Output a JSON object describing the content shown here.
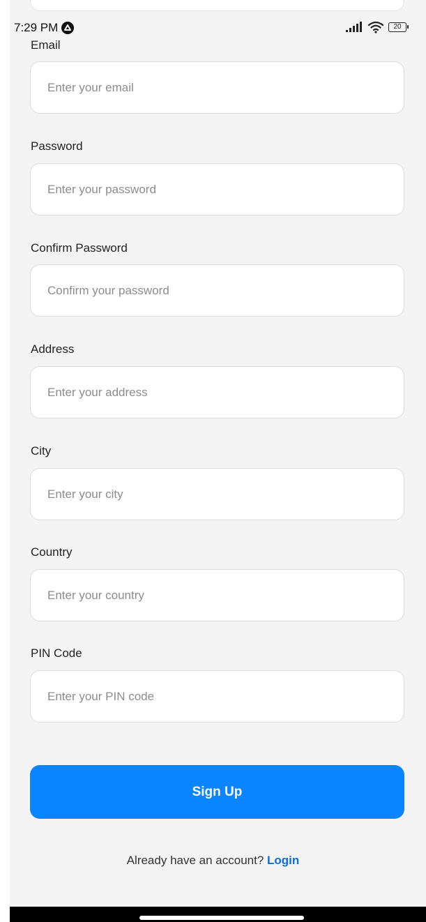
{
  "status_bar": {
    "time": "7:29 PM",
    "battery": "20"
  },
  "form": {
    "fields": [
      {
        "label": "Email",
        "placeholder": "Enter your email"
      },
      {
        "label": "Password",
        "placeholder": "Enter your password"
      },
      {
        "label": "Confirm Password",
        "placeholder": "Confirm your password"
      },
      {
        "label": "Address",
        "placeholder": "Enter your address"
      },
      {
        "label": "City",
        "placeholder": "Enter your city"
      },
      {
        "label": "Country",
        "placeholder": "Enter your country"
      },
      {
        "label": "PIN Code",
        "placeholder": "Enter your PIN code"
      }
    ],
    "submit_label": "Sign Up"
  },
  "footer": {
    "prompt": "Already have an account?",
    "login_label": "Login"
  },
  "colors": {
    "primary": "#0a84ff",
    "link": "#0a6fd8",
    "background": "#f4f4f4"
  },
  "icons": {
    "notification": "app-notification-icon",
    "signal": "signal-icon",
    "wifi": "wifi-icon",
    "battery": "battery-icon"
  }
}
